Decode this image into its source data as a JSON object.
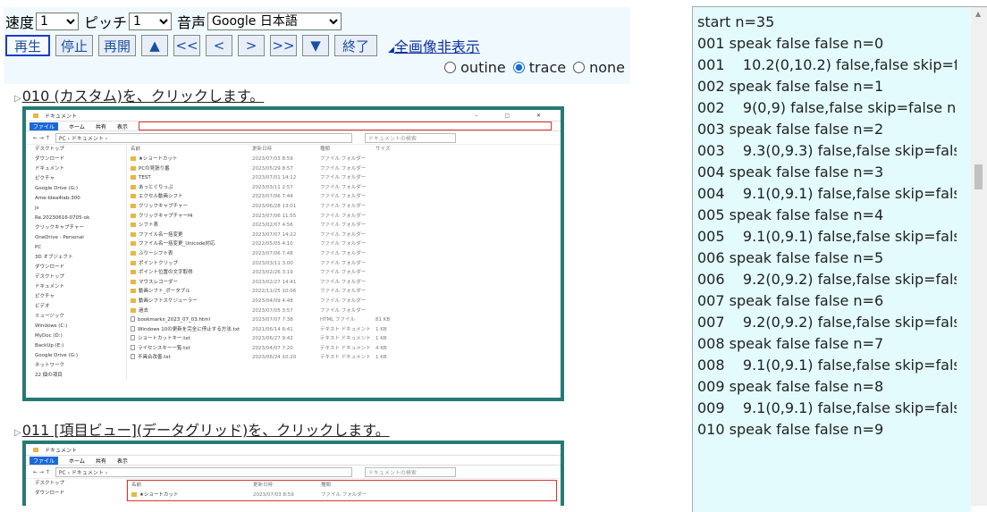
{
  "controls": {
    "speed_label": "速度",
    "speed_value": "1",
    "pitch_label": "ピッチ",
    "pitch_value": "1",
    "voice_label": "音声",
    "voice_value": "Google 日本語",
    "buttons": {
      "play": "再生",
      "stop": "停止",
      "resume": "再開",
      "up": "▲",
      "first": "<<",
      "prev": "<",
      "next": ">",
      "last": ">>",
      "down": "▼",
      "end": "終了"
    },
    "hide_link": "全画像非表示",
    "radio": {
      "outline": "outine",
      "trace": "trace",
      "none": "none",
      "selected": "trace"
    }
  },
  "steps": [
    {
      "title": "010 (カスタム)を、クリックします。"
    },
    {
      "title": "011 [項目ビュー](データグリッド)を、クリックします。"
    }
  ],
  "explorer": {
    "title": "ドキュメント",
    "ribbon": [
      "ファイル",
      "ホーム",
      "共有",
      "表示"
    ],
    "path": "PC › ドキュメント ›",
    "search": "ドキュメントの検索",
    "nav": [
      "デスクトップ",
      "ダウンロード",
      "ドキュメント",
      "ピクチャ",
      "Google Drive (G:)",
      "Ame-Idea4lab-300",
      "js",
      "Re.20230616-0705-ok",
      "クリックキャプチャー",
      "OneDrive - Personal",
      "PC",
      "3D オブジェクト",
      "ダウンロード",
      "デスクトップ",
      "ドキュメント",
      "ピクチャ",
      "ビデオ",
      "ミュージック",
      "Windows (C:)",
      "MyDoc (D:)",
      "BackUp (E:)",
      "Google Drive (G:)",
      "ネットワーク",
      "22 個の項目"
    ],
    "headers": [
      "名前",
      "更新日時",
      "種類",
      "サイズ"
    ],
    "rows": [
      [
        "★ショートカット",
        "2023/07/03 8:59",
        "ファイル フォルダー",
        ""
      ],
      [
        "PCの見張り番",
        "2023/05/29 8:57",
        "ファイル フォルダー",
        ""
      ],
      [
        "TEST",
        "2023/07/01 14:12",
        "ファイル フォルダー",
        ""
      ],
      [
        "あっとぐりっぷ",
        "2023/03/11 2:57",
        "ファイル フォルダー",
        ""
      ],
      [
        "エクセル動画シフト",
        "2023/07/06 7:44",
        "ファイル フォルダー",
        ""
      ],
      [
        "クリックキャプチャー",
        "2023/06/28 13:01",
        "ファイル フォルダー",
        ""
      ],
      [
        "クリックキャプチャーf4",
        "2023/07/06 11:55",
        "ファイル フォルダー",
        ""
      ],
      [
        "シフト表",
        "2023/02/07 4:56",
        "ファイル フォルダー",
        ""
      ],
      [
        "ファイル名一括変更",
        "2023/07/07 14:22",
        "ファイル フォルダー",
        ""
      ],
      [
        "ファイル名一括変更_Unicode対応",
        "2022/05/05 4:10",
        "ファイル フォルダー",
        ""
      ],
      [
        "ふりーシフト表",
        "2023/07/06 7:48",
        "ファイル フォルダー",
        ""
      ],
      [
        "ポイントクリップ",
        "2023/03/11 3:00",
        "ファイル フォルダー",
        ""
      ],
      [
        "ポイント位置の文字取得",
        "2023/02/26 3:19",
        "ファイル フォルダー",
        ""
      ],
      [
        "マウスレコーダー",
        "2023/02/27 14:41",
        "ファイル フォルダー",
        ""
      ],
      [
        "動画シフト_ポータブル",
        "2022/11/25 10:06",
        "ファイル フォルダー",
        ""
      ],
      [
        "動画シフトスケジューラー",
        "2023/04/09 4:48",
        "ファイル フォルダー",
        ""
      ],
      [
        "過去",
        "2023/07/05 3:57",
        "ファイル フォルダー",
        ""
      ],
      [
        "bookmarks_2023_07_03.html",
        "2023/07/07 7:38",
        "HTML ファイル",
        "81 KB"
      ],
      [
        "Windows 10の更新を完全に停止する方法.txt",
        "2021/06/14 6:41",
        "テキスト ドキュメント",
        "1 KB"
      ],
      [
        "ショートカットキー.txt",
        "2023/06/27 9:42",
        "テキスト ドキュメント",
        "1 KB"
      ],
      [
        "ライセンスキー一覧.txt",
        "2023/04/07 7:20",
        "テキスト ドキュメント",
        "4 KB"
      ],
      [
        "不具合改善.txt",
        "2023/06/24 10:20",
        "テキスト ドキュメント",
        "1 KB"
      ]
    ]
  },
  "log": [
    "start n=35",
    "001 speak false false n=0",
    "001    10.2(0,10.2) false,false skip=f",
    "002 speak false false n=1",
    "002    9(0,9) false,false skip=false n=",
    "003 speak false false n=2",
    "003    9.3(0,9.3) false,false skip=fals",
    "004 speak false false n=3",
    "004    9.1(0,9.1) false,false skip=fals",
    "005 speak false false n=4",
    "005    9.1(0,9.1) false,false skip=fals",
    "006 speak false false n=5",
    "006    9.2(0,9.2) false,false skip=fals",
    "007 speak false false n=6",
    "007    9.2(0,9.2) false,false skip=fals",
    "008 speak false false n=7",
    "008    9.1(0,9.1) false,false skip=fals",
    "009 speak false false n=8",
    "009    9.1(0,9.1) false,false skip=fals",
    "010 speak false false n=9"
  ]
}
